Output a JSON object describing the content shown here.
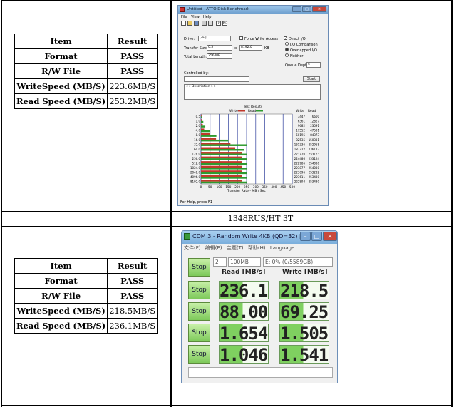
{
  "top_table": {
    "headers": [
      "Item",
      "Result"
    ],
    "rows": [
      [
        "Format",
        "PASS"
      ],
      [
        "R/W File",
        "PASS"
      ],
      [
        "WriteSpeed (MB/S)",
        "223.6MB/S"
      ],
      [
        "Read  Speed (MB/S)",
        "253.2MB/S"
      ]
    ]
  },
  "bottom_table": {
    "headers": [
      "Item",
      "Result"
    ],
    "rows": [
      [
        "Format",
        "PASS"
      ],
      [
        "R/W File",
        "PASS"
      ],
      [
        "WriteSpeed (MB/S)",
        "218.5MB/S"
      ],
      [
        "Read  Speed (MB/S)",
        "236.1MB/S"
      ]
    ]
  },
  "caption": "1348RUS/HT 3T",
  "atto": {
    "title": "Untitled - ATTO Disk Benchmark",
    "menu": [
      "File",
      "View",
      "Help"
    ],
    "drive_label": "Drive:",
    "drive_value": "[-e-]",
    "force_write": "Force Write Access",
    "transfer_label": "Transfer Size:",
    "transfer_from": "0.5",
    "transfer_to": "8192.0",
    "transfer_unit": "KB",
    "total_label": "Total Length:",
    "total_value": "256 MB",
    "direct_io": "Direct I/O",
    "io_comparison": "I/O Comparison",
    "overlapped_io": "Overlapped I/O",
    "neither": "Neither",
    "queue_label": "Queue Depth:",
    "queue_value": "4",
    "controlled_label": "Controlled by:",
    "start_button": "Start",
    "description": "<< Description >>",
    "test_results": "Test Results",
    "legend_write": "Write",
    "legend_read": "Read",
    "col_write": "Write",
    "col_read": "Read",
    "xaxis_label": "Transfer Rate - MB / Sec",
    "status": "For Help, press F1"
  },
  "chart_data": {
    "type": "bar",
    "title": "Test Results",
    "categories": [
      "0.5",
      "1.0",
      "2.0",
      "4.0",
      "8.0",
      "16.0",
      "32.0",
      "64.0",
      "128.0",
      "256.0",
      "512.0",
      "1024.0",
      "2048.0",
      "4096.0",
      "8192.0"
    ],
    "series": [
      {
        "name": "Write",
        "values": [
          3.5,
          6.4,
          9.7,
          17.6,
          50.2,
          82.5,
          161.3,
          187.7,
          223.8,
          224.5,
          223.0,
          223.9,
          223.7,
          223.6,
          222.9
        ]
      },
      {
        "name": "Read",
        "values": [
          6.6,
          12.8,
          23.6,
          47.5,
          84.4,
          150.3,
          253.0,
          236.2,
          253.1,
          253.1,
          254.0,
          254.0,
          253.2,
          253.4,
          253.4
        ]
      }
    ],
    "write_labels": [
      "3447",
      "6361",
      "9682",
      "17552",
      "50195",
      "82535",
      "161336",
      "187722",
      "223770",
      "224486",
      "222986",
      "223877",
      "223696",
      "223611",
      "222894"
    ],
    "read_labels": [
      "6600",
      "12827",
      "23591",
      "47531",
      "84373",
      "150331",
      "252958",
      "236173",
      "253123",
      "253124",
      "254030",
      "254030",
      "253232",
      "253430",
      "253430"
    ],
    "xticks": [
      "0",
      "50",
      "100",
      "150",
      "200",
      "250",
      "300",
      "350",
      "400",
      "450",
      "500"
    ],
    "xlim": [
      0,
      500
    ],
    "xlabel": "Transfer Rate - MB / Sec",
    "legend": "top"
  },
  "cdm": {
    "title": "CDM 3 - Random Write 4KB (QD=32) [2/2]",
    "menu": [
      "文件(F)",
      "编辑(E)",
      "主题(T)",
      "帮助(H)",
      "Language"
    ],
    "count": "2",
    "size": "100MB",
    "drive": "E: 0% (0/5589GB)",
    "read_header": "Read [MB/s]",
    "write_header": "Write [MB/s]",
    "stop_label": "Stop",
    "rows": [
      {
        "read": "236.1",
        "write": "218.5"
      },
      {
        "read": "88.00",
        "write": "69.25"
      },
      {
        "read": "1.654",
        "write": "1.505"
      },
      {
        "read": "1.046",
        "write": "1.541"
      }
    ]
  }
}
